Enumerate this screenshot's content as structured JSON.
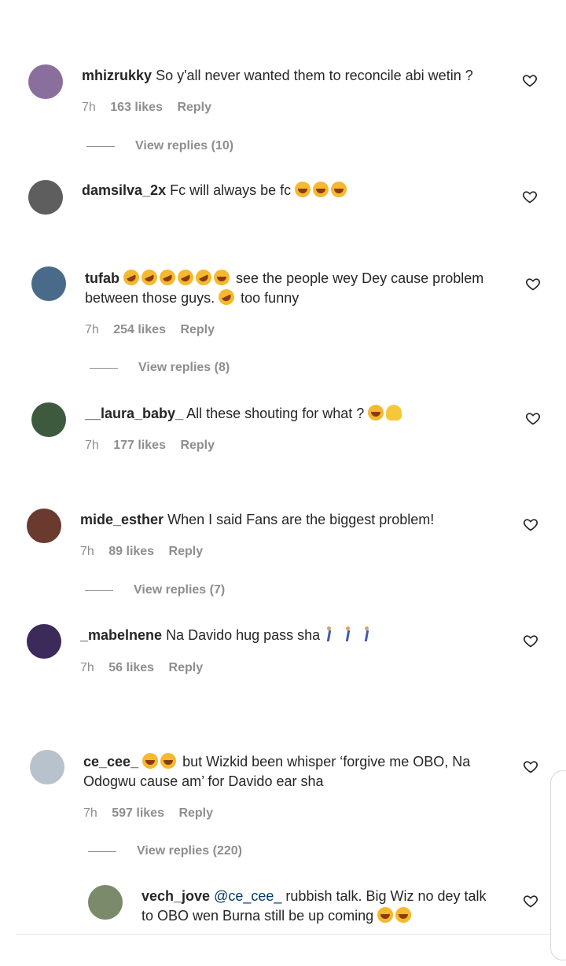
{
  "comments": [
    {
      "user": "mhizrukky",
      "text": "So y'all never wanted them to reconcile abi wetin ?",
      "time": "7h",
      "likes": "163 likes",
      "reply": "Reply",
      "view_replies": "View replies (10)",
      "avatar_color": "#8a6f9e"
    },
    {
      "user": "damsilva_2x",
      "text": "Fc will always be fc",
      "avatar_color": "#5e5e5e"
    },
    {
      "user": "tufab",
      "text": "see the people wey Dey cause problem between those guys.",
      "text_tail": "too funny",
      "time": "7h",
      "likes": "254 likes",
      "reply": "Reply",
      "view_replies": "View replies (8)",
      "avatar_color": "#4a6a8a"
    },
    {
      "user": "__laura_baby_",
      "text": "All these shouting for what ?",
      "time": "7h",
      "likes": "177 likes",
      "reply": "Reply",
      "avatar_color": "#3d5a3e"
    },
    {
      "user": "mide_esther",
      "text": "When I said Fans are the biggest problem!",
      "time": "7h",
      "likes": "89 likes",
      "reply": "Reply",
      "view_replies": "View replies (7)",
      "avatar_color": "#6b3a2e"
    },
    {
      "user": "_mabelnene",
      "text": "Na Davido hug pass sha",
      "time": "7h",
      "likes": "56 likes",
      "reply": "Reply",
      "avatar_color": "#3b2a5a"
    },
    {
      "user": "ce_cee_",
      "text": "but Wizkid been whisper ‘forgive me OBO, Na Odogwu cause am’ for Davido ear sha",
      "time": "7h",
      "likes": "597 likes",
      "reply": "Reply",
      "view_replies": "View replies (220)",
      "avatar_color": "#b7c2cc"
    },
    {
      "user": "vech_jove",
      "mention": "@ce_cee_",
      "text": "rubbish talk. Big Wiz no dey talk to OBO wen Burna still be up coming",
      "avatar_color": "#7a8a6a"
    }
  ],
  "colors": {
    "meta": "#8e8e8e",
    "mention": "#00376b",
    "text": "#262626"
  },
  "icons": {
    "like": "heart-outline-icon"
  }
}
